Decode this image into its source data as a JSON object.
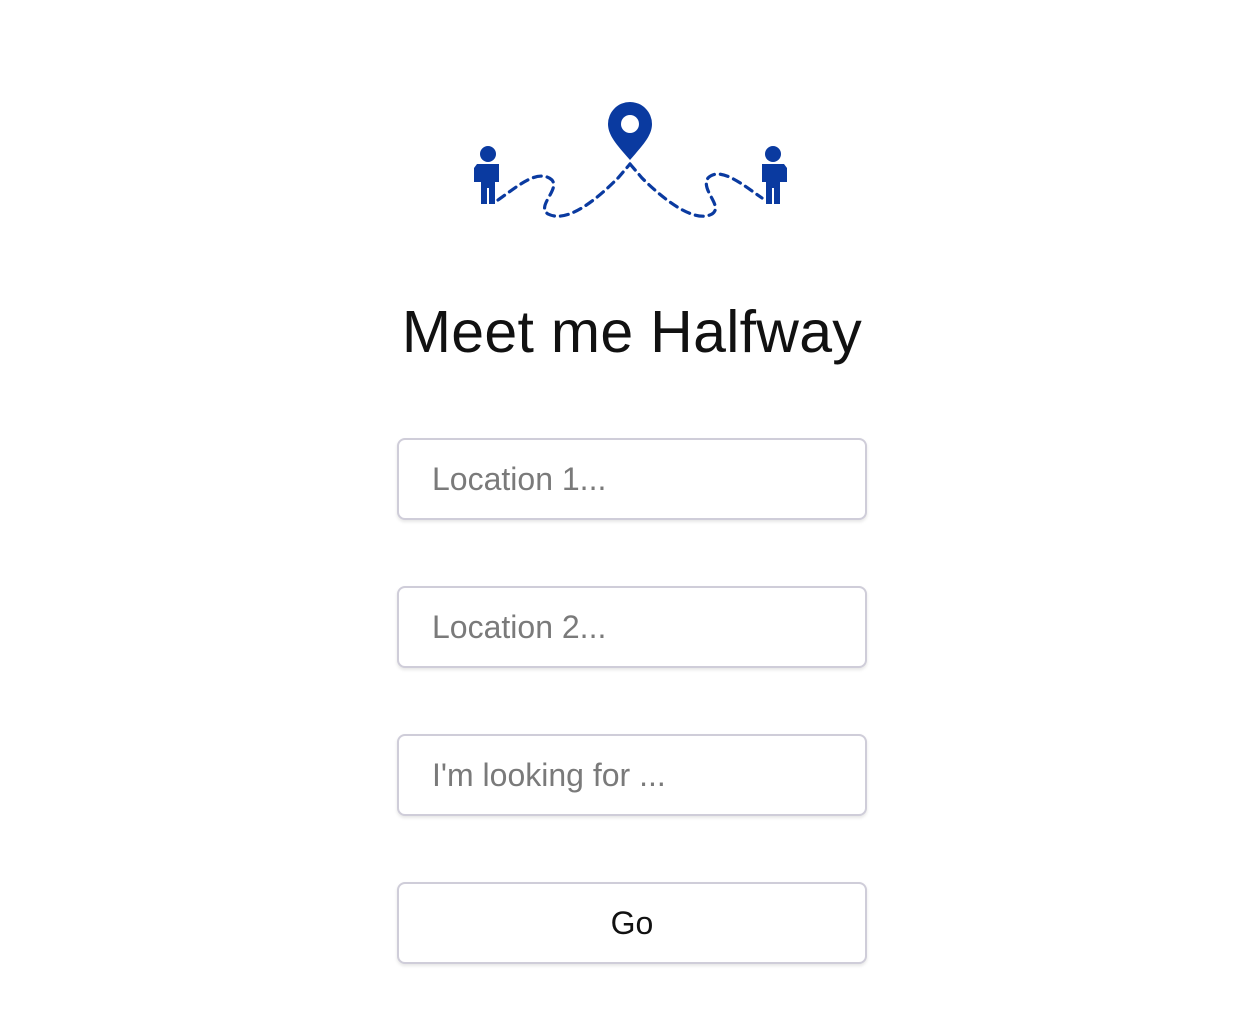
{
  "header": {
    "logo_icon": "meeting-point-map-icon",
    "title": "Meet me Halfway"
  },
  "form": {
    "location1_placeholder": "Location 1...",
    "location1_value": "",
    "location2_placeholder": "Location 2...",
    "location2_value": "",
    "looking_for_placeholder": "I'm looking for ...",
    "looking_for_value": "",
    "go_label": "Go"
  },
  "colors": {
    "brand": "#0a3aa0",
    "field_border": "#cfcdd9",
    "placeholder": "#7a7a7a",
    "text": "#111111",
    "background": "#ffffff"
  }
}
